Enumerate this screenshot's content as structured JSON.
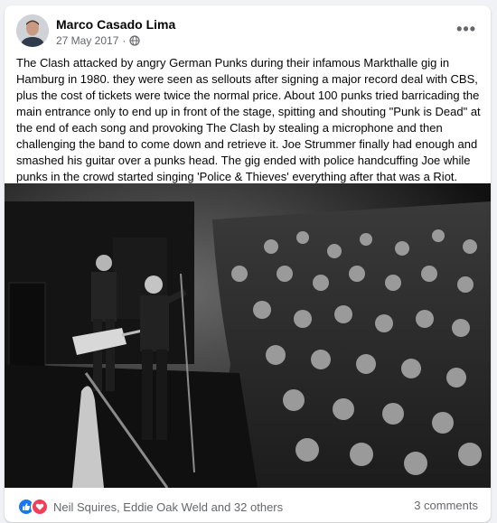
{
  "post": {
    "author": "Marco Casado Lima",
    "date": "27 May 2017",
    "privacy_sep": "·",
    "privacy_icon": "globe-icon",
    "more_label": "•••",
    "text": "The Clash attacked by angry German Punks during their infamous Markthalle gig in Hamburg in 1980. they were seen as sellouts after signing a major record deal with CBS, plus the cost of tickets were twice the normal price. About 100 punks tried barricading the main entrance only to end up in front of the stage, spitting and shouting \"Punk is Dead\" at the end of each song and provoking The Clash by stealing a microphone and then challenging the band to come down and retrieve it. Joe Strummer finally had enough and smashed his guitar over a punks head. The gig ended with police handcuffing Joe while punks in the crowd started singing 'Police & Thieves' everything after that was a Riot."
  },
  "footer": {
    "reactions_text": "Neil Squires, Eddie Oak Weld and 32 others",
    "comments_text": "3 comments",
    "reaction_icons": [
      "like-icon",
      "love-icon"
    ]
  },
  "colors": {
    "page_bg": "#f0f2f5",
    "card_bg": "#ffffff",
    "like_blue": "#1877f2",
    "love_red": "#f33e58",
    "secondary_text": "#65676b"
  }
}
